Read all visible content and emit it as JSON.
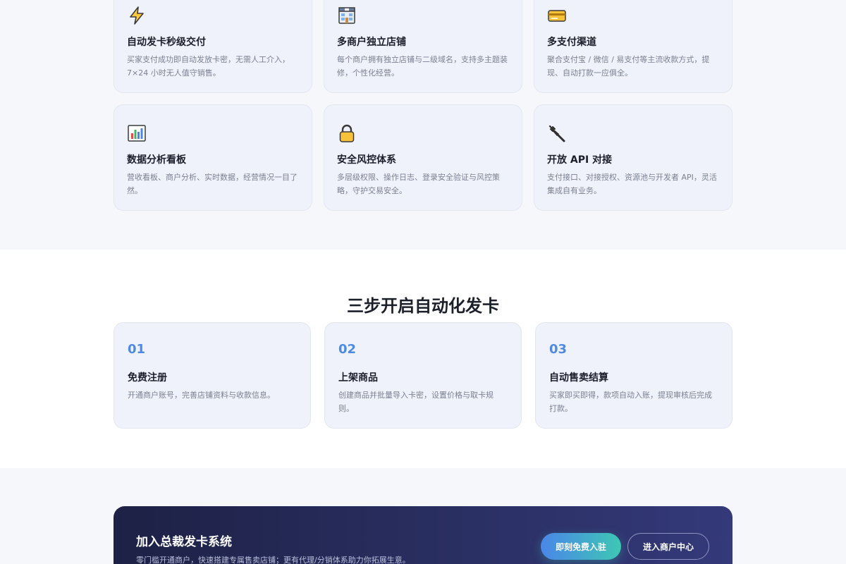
{
  "features": [
    {
      "icon": "lightning-icon",
      "title": "自动发卡秒级交付",
      "desc": "买家支付成功即自动发放卡密，无需人工介入，7×24 小时无人值守销售。"
    },
    {
      "icon": "store-icon",
      "title": "多商户独立店铺",
      "desc": "每个商户拥有独立店铺与二级域名，支持多主题装修，个性化经营。"
    },
    {
      "icon": "credit-card-icon",
      "title": "多支付渠道",
      "desc": "聚合支付宝 / 微信 / 易支付等主流收款方式，提现、自动打款一应俱全。"
    },
    {
      "icon": "bar-chart-icon",
      "title": "数据分析看板",
      "desc": "营收看板、商户分析、实时数据，经营情况一目了然。"
    },
    {
      "icon": "lock-icon",
      "title": "安全风控体系",
      "desc": "多层级权限、操作日志、登录安全验证与风控策略，守护交易安全。"
    },
    {
      "icon": "plug-icon",
      "title": "开放 API 对接",
      "desc": "支付接口、对接授权、资源池与开发者 API，灵活集成自有业务。"
    }
  ],
  "steps": {
    "title": "三步开启自动化发卡",
    "items": [
      {
        "num": "01",
        "title": "免费注册",
        "desc": "开通商户账号，完善店铺资料与收款信息。"
      },
      {
        "num": "02",
        "title": "上架商品",
        "desc": "创建商品并批量导入卡密，设置价格与取卡规则。"
      },
      {
        "num": "03",
        "title": "自动售卖结算",
        "desc": "买家即买即得，款项自动入账，提现审核后完成打款。"
      }
    ]
  },
  "cta": {
    "title": "加入总裁发卡系统",
    "subtitle": "零门槛开通商户，快速搭建专属售卖店铺；更有代理/分销体系助力你拓展生意。",
    "primary_label": "即刻免费入驻",
    "secondary_label": "进入商户中心"
  },
  "colors": {
    "accent": "#4d8be3",
    "card_bg": "#eff2fa",
    "cta_bg": "#2a2f62",
    "primary_gradient_start": "#4a86e8",
    "primary_gradient_end": "#3ec7b4"
  }
}
